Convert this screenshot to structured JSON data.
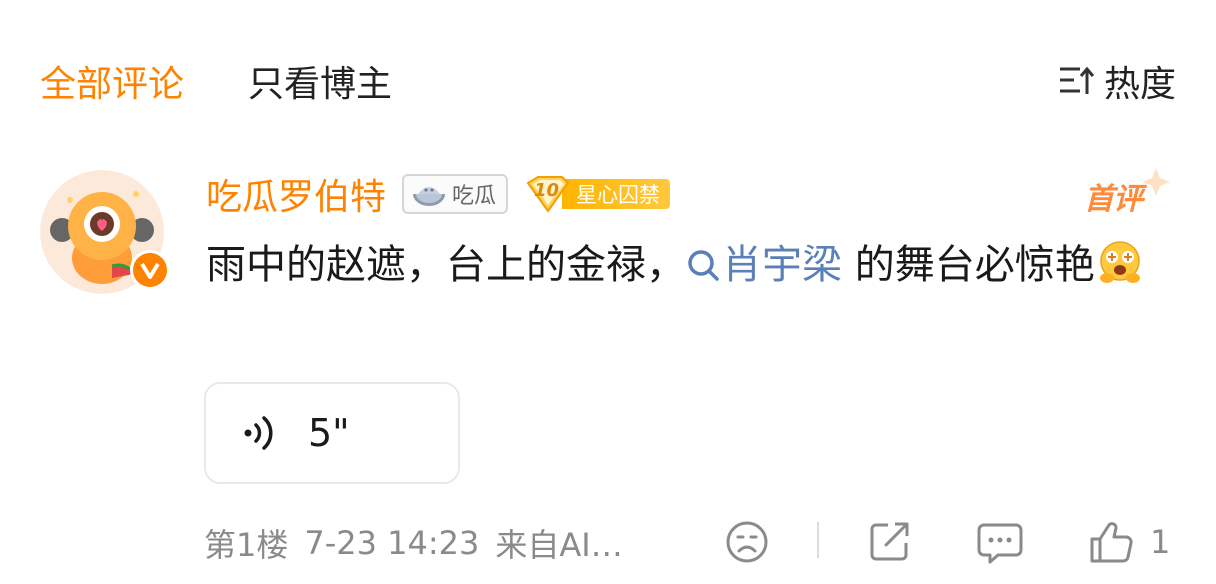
{
  "tabs": {
    "all": "全部评论",
    "author_only": "只看博主"
  },
  "sort": {
    "label": "热度",
    "icon": "sort-icon"
  },
  "comment": {
    "username": "吃瓜罗伯特",
    "badge_group": {
      "label": "吃瓜",
      "icon": "watermelon-icon"
    },
    "badge_fan": {
      "level": "10",
      "label": "星心囚禁"
    },
    "first_comment_label": "首评",
    "verified_icon": "v-badge-icon",
    "text_before": "雨中的赵遮，台上的金禄，",
    "mention": "肖宇梁",
    "text_after": "的舞台必惊艳",
    "emoji": "smiling-hugging-emoji",
    "voice_duration": "5\"",
    "floor": "第1楼",
    "time": "7-23 14:23",
    "source": "来自AI…",
    "like_count": "1"
  },
  "colors": {
    "accent": "#ff8200",
    "mention": "#5b7fb8",
    "meta": "#8a8a8a"
  }
}
